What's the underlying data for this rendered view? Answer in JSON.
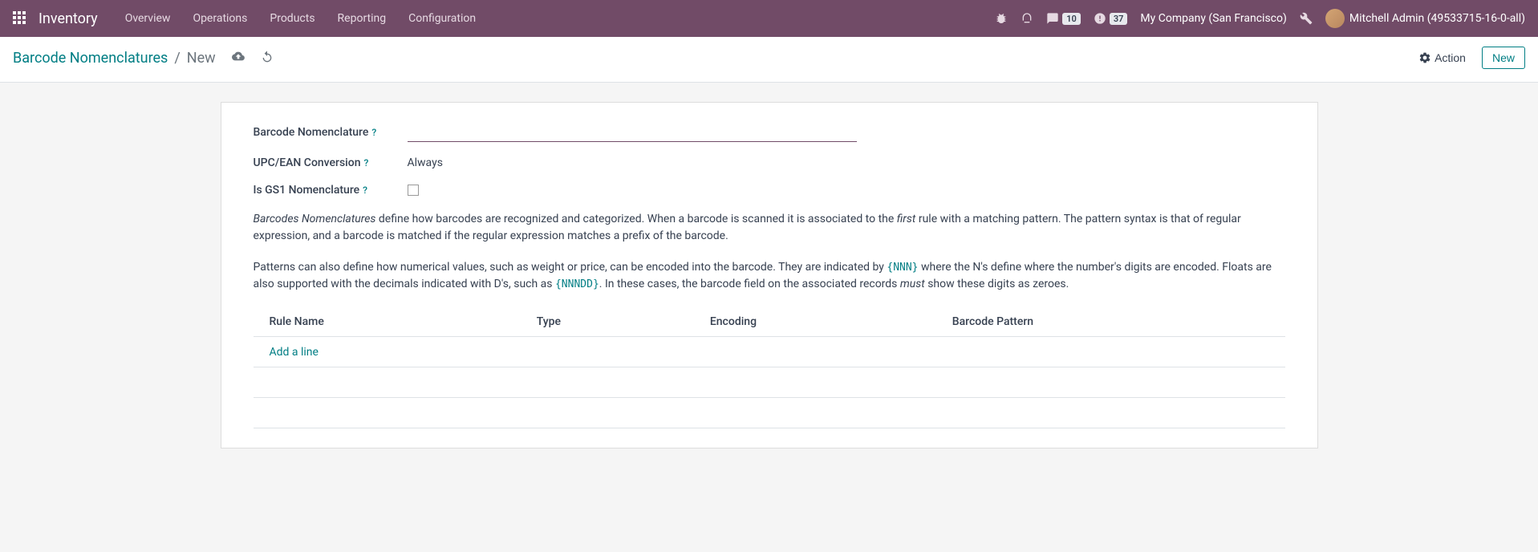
{
  "navbar": {
    "brand": "Inventory",
    "menu": [
      "Overview",
      "Operations",
      "Products",
      "Reporting",
      "Configuration"
    ],
    "messages_badge": "10",
    "activities_badge": "37",
    "company": "My Company (San Francisco)",
    "user": "Mitchell Admin (49533715-16-0-all)"
  },
  "breadcrumb": {
    "parent": "Barcode Nomenclatures",
    "current": "New"
  },
  "buttons": {
    "action": "Action",
    "new": "New"
  },
  "form": {
    "nomenclature_label": "Barcode Nomenclature",
    "nomenclature_value": "",
    "conversion_label": "UPC/EAN Conversion",
    "conversion_value": "Always",
    "gs1_label": "Is GS1 Nomenclature"
  },
  "help": {
    "p1_a": "Barcodes Nomenclatures",
    "p1_b": " define how barcodes are recognized and categorized. When a barcode is scanned it is associated to the ",
    "p1_c": "first",
    "p1_d": " rule with a matching pattern. The pattern syntax is that of regular expression, and a barcode is matched if the regular expression matches a prefix of the barcode.",
    "p2_a": "Patterns can also define how numerical values, such as weight or price, can be encoded into the barcode. They are indicated by ",
    "p2_b": "{NNN}",
    "p2_c": " where the N's define where the number's digits are encoded. Floats are also supported with the decimals indicated with D's, such as ",
    "p2_d": "{NNNDD}",
    "p2_e": ". In these cases, the barcode field on the associated records ",
    "p2_f": "must",
    "p2_g": " show these digits as zeroes."
  },
  "table": {
    "headers": [
      "Rule Name",
      "Type",
      "Encoding",
      "Barcode Pattern"
    ],
    "add_line": "Add a line"
  }
}
